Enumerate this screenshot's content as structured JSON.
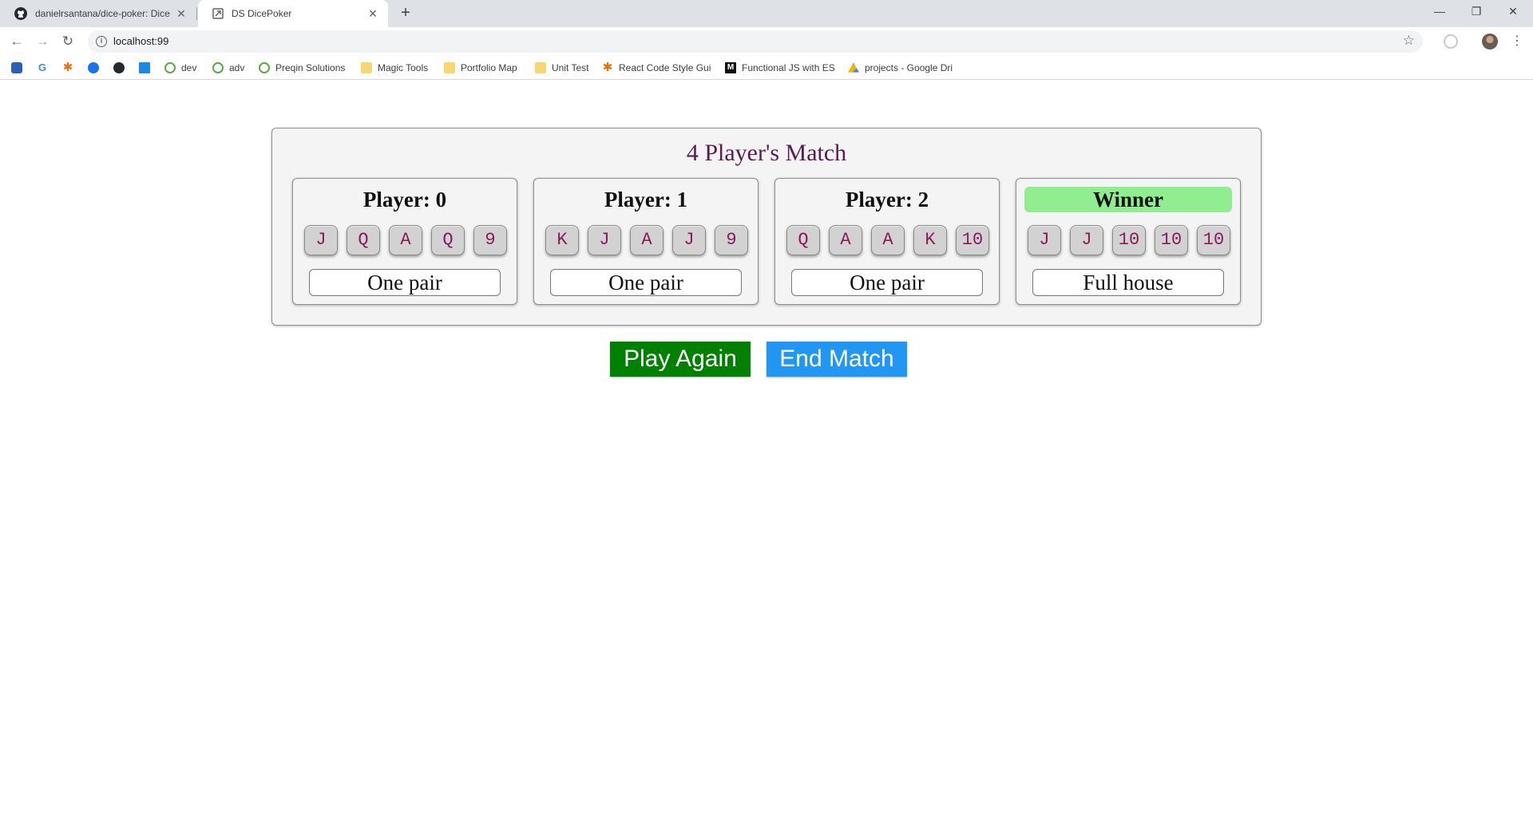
{
  "browser": {
    "tabs": [
      {
        "title": "danielrsantana/dice-poker: Dice",
        "icon": "github-icon",
        "active": false
      },
      {
        "title": "DS DicePoker",
        "icon": "app-icon",
        "active": true
      }
    ],
    "new_tab": "+",
    "window_controls": {
      "minimize": "—",
      "restore": "❐",
      "close": "✕"
    },
    "url": "localhost:99",
    "bookmarks": [
      {
        "label": "",
        "icon": "jira-icon"
      },
      {
        "label": "",
        "icon": "google-icon"
      },
      {
        "label": "",
        "icon": "asterisk-icon"
      },
      {
        "label": "",
        "icon": "chat-icon"
      },
      {
        "label": "",
        "icon": "github-icon"
      },
      {
        "label": "",
        "icon": "flow-icon"
      },
      {
        "label": "dev",
        "icon": "qlik-icon"
      },
      {
        "label": "adv",
        "icon": "qlik-icon"
      },
      {
        "label": "Preqin Solutions",
        "icon": "qlik-icon"
      },
      {
        "label": "Magic Tools",
        "icon": "folder-icon"
      },
      {
        "label": "Portfolio Map",
        "icon": "folder-icon"
      },
      {
        "label": "Unit Test",
        "icon": "folder-icon"
      },
      {
        "label": "React Code Style Gui",
        "icon": "react-icon"
      },
      {
        "label": "Functional JS with ES",
        "icon": "medium-icon"
      },
      {
        "label": "projects - Google Dri",
        "icon": "drive-icon"
      }
    ]
  },
  "game": {
    "title": "4 Player's Match",
    "players": [
      {
        "name": "Player: 0",
        "winner": false,
        "dice": [
          "J",
          "Q",
          "A",
          "Q",
          "9"
        ],
        "hand": "One pair"
      },
      {
        "name": "Player: 1",
        "winner": false,
        "dice": [
          "K",
          "J",
          "A",
          "J",
          "9"
        ],
        "hand": "One pair"
      },
      {
        "name": "Player: 2",
        "winner": false,
        "dice": [
          "Q",
          "A",
          "A",
          "K",
          "10"
        ],
        "hand": "One pair"
      },
      {
        "name": "Winner",
        "winner": true,
        "dice": [
          "J",
          "J",
          "10",
          "10",
          "10"
        ],
        "hand": "Full house"
      }
    ],
    "play_again_label": "Play Again",
    "end_match_label": "End Match"
  },
  "colors": {
    "title": "#5b1a52",
    "die_text": "#8b1a5a",
    "winner_bg": "#90ee90",
    "play_again_bg": "#008000",
    "end_match_bg": "#2196f3"
  }
}
